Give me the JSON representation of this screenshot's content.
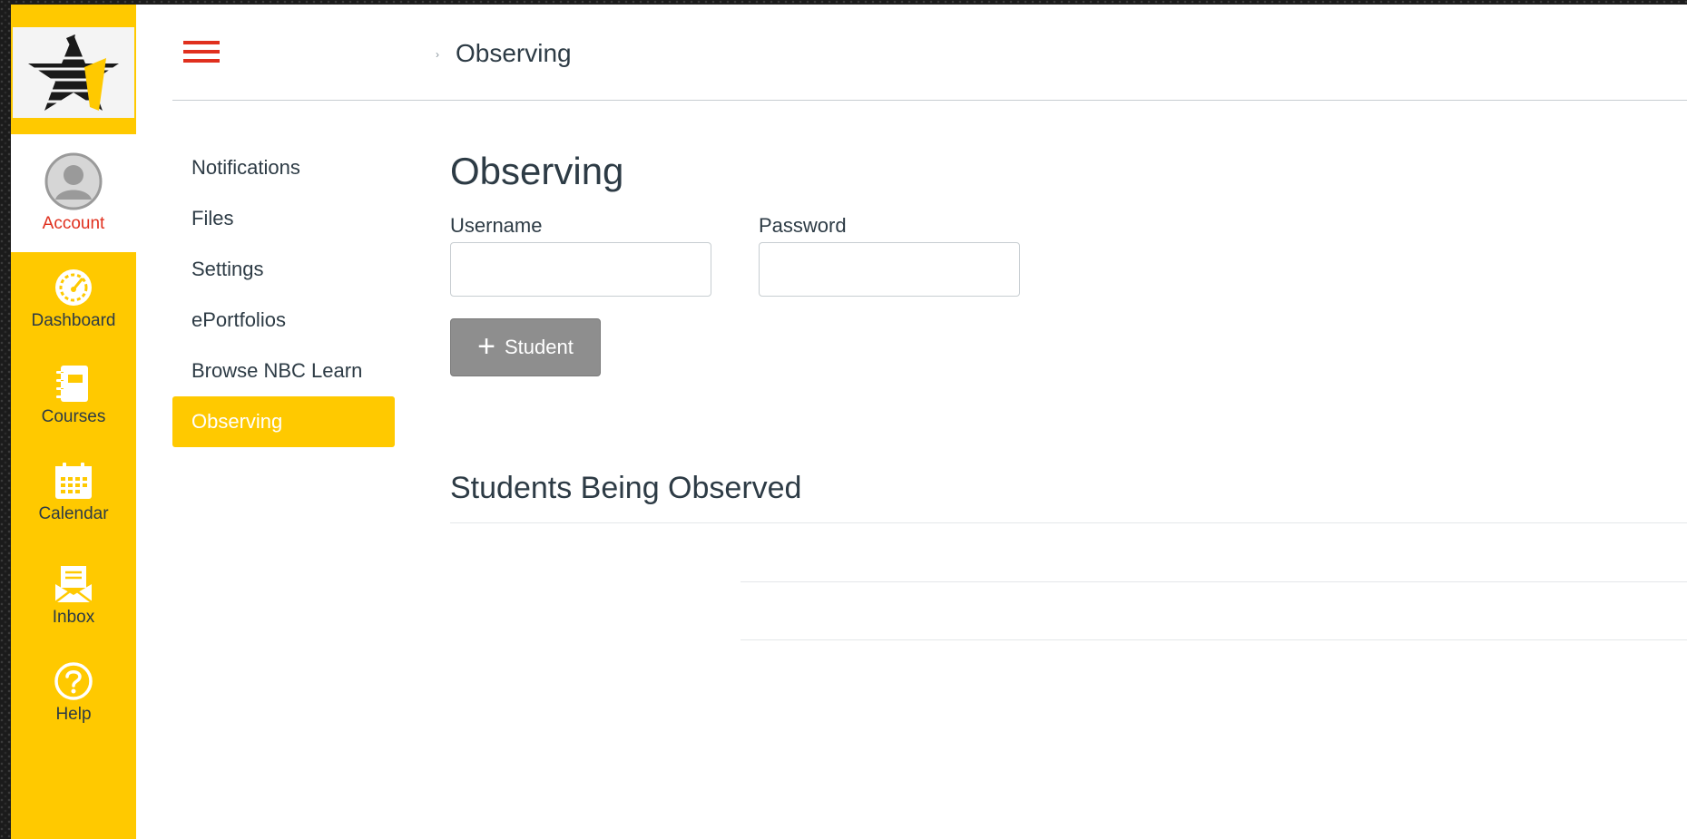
{
  "global_nav": {
    "items": [
      {
        "id": "account",
        "label": "Account",
        "icon": "avatar-icon",
        "active": true
      },
      {
        "id": "dashboard",
        "label": "Dashboard",
        "icon": "speedometer-icon",
        "active": false
      },
      {
        "id": "courses",
        "label": "Courses",
        "icon": "notebook-icon",
        "active": false
      },
      {
        "id": "calendar",
        "label": "Calendar",
        "icon": "calendar-icon",
        "active": false
      },
      {
        "id": "inbox",
        "label": "Inbox",
        "icon": "inbox-icon",
        "active": false
      },
      {
        "id": "help",
        "label": "Help",
        "icon": "help-icon",
        "active": false
      }
    ]
  },
  "header": {
    "breadcrumb_current": "Observing"
  },
  "section_nav": {
    "items": [
      {
        "label": "Notifications",
        "active": false
      },
      {
        "label": "Files",
        "active": false
      },
      {
        "label": "Settings",
        "active": false
      },
      {
        "label": "ePortfolios",
        "active": false
      },
      {
        "label": "Browse NBC Learn",
        "active": false
      },
      {
        "label": "Observing",
        "active": true
      }
    ]
  },
  "main": {
    "title": "Observing",
    "username_label": "Username",
    "username_value": "",
    "password_label": "Password",
    "password_value": "",
    "add_button_label": "Student",
    "observed_heading": "Students Being Observed"
  },
  "colors": {
    "brand_yellow": "#ffc900",
    "active_red": "#e0301e",
    "text": "#2d3b45",
    "button_gray": "#8e8e8e"
  }
}
